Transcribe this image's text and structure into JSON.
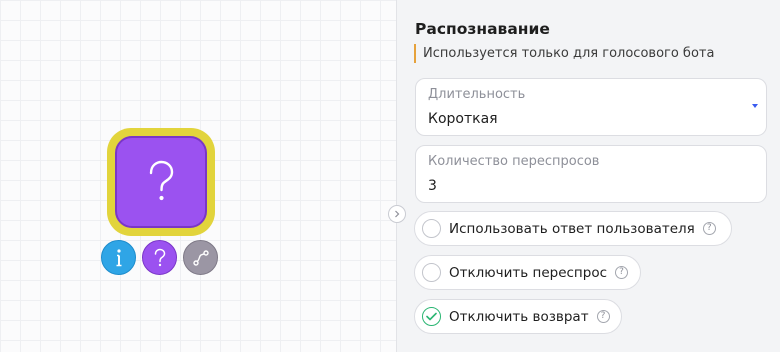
{
  "canvas": {
    "node": {
      "symbol": "?",
      "icon": "question-icon",
      "border_color": "#e2d43c",
      "fill_color": "#9b52f0"
    },
    "actions": [
      {
        "icon": "info-icon",
        "glyph": "i",
        "color": "#2fa5e6"
      },
      {
        "icon": "question-icon",
        "glyph": "?",
        "color": "#9b52f0"
      },
      {
        "icon": "route-icon",
        "color": "#9b96a4"
      }
    ]
  },
  "panel": {
    "title": "Распознавание",
    "note": "Используется только для голосового бота",
    "duration": {
      "label": "Длительность",
      "value": "Короткая"
    },
    "reprompts": {
      "label": "Количество переспросов",
      "value": "3"
    },
    "options": [
      {
        "label": "Использовать ответ пользователя",
        "checked": false,
        "hint": "?"
      },
      {
        "label": "Отключить переспрос",
        "checked": false,
        "hint": "?"
      },
      {
        "label": "Отключить возврат",
        "checked": true,
        "hint": "?"
      }
    ],
    "accent_color": "#e6a23c",
    "check_color": "#2bb673"
  }
}
